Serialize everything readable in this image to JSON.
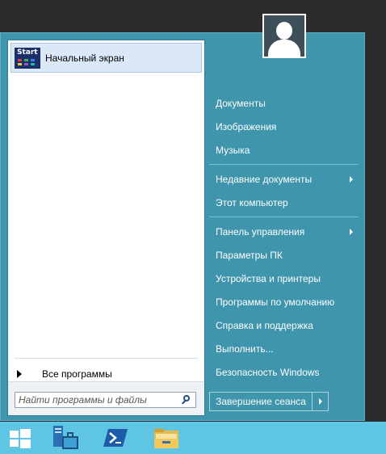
{
  "pinned": {
    "tile_text": "Start",
    "label": "Начальный экран"
  },
  "all_programs": "Все программы",
  "search": {
    "placeholder": "Найти программы и файлы"
  },
  "right_menu": {
    "documents": "Документы",
    "pictures": "Изображения",
    "music": "Музыка",
    "recent": "Недавние документы",
    "computer": "Этот компьютер",
    "control_panel": "Панель управления",
    "pc_settings": "Параметры ПК",
    "devices": "Устройства и принтеры",
    "default_programs": "Программы по умолчанию",
    "help": "Справка и поддержка",
    "run": "Выполнить...",
    "security": "Безопасность Windows"
  },
  "shutdown_label": "Завершение сеанса",
  "icons": {
    "avatar": "user-avatar-icon",
    "start": "windows-logo-icon",
    "server_manager": "server-manager-icon",
    "powershell": "powershell-icon",
    "explorer": "file-explorer-icon"
  },
  "colors": {
    "menu_bg": "#3f95ac",
    "taskbar_bg": "#5ec5e4",
    "desktop_bg": "#2b2b2b"
  }
}
